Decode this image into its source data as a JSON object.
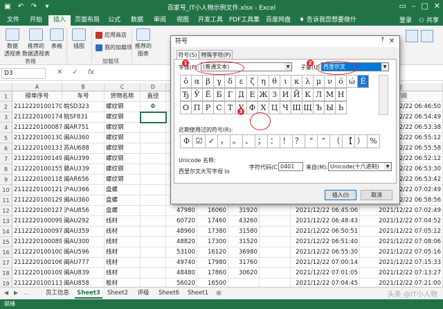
{
  "app": {
    "title": "百家号_IT小人物示例文件.xlsx - Excel",
    "ribbon_tabs": [
      "文件",
      "开始",
      "插入",
      "页面布局",
      "公式",
      "数据",
      "审阅",
      "视图",
      "开发工具",
      "PDF工具集",
      "百度网盘"
    ],
    "active_tab": "插入",
    "tell_me": "告诉我您想要做什么...",
    "login": "登录",
    "share": "共享"
  },
  "ribbon": {
    "pivot": "数据\n透视表",
    "recommended_pivot": "推荐的\n数据透视表",
    "table": "表格",
    "group_tables": "表格",
    "illustrations": "插图",
    "app_store": "应用商店",
    "my_addins": "我的加载项",
    "group_addins": "加载项",
    "recommended_charts": "推荐的\n图表"
  },
  "formula_bar": {
    "name_box": "D3",
    "cancel": "✕",
    "enter": "✓",
    "fx": "fx"
  },
  "sheet": {
    "columns": [
      "A",
      "B",
      "C",
      "D",
      "E",
      "F",
      "G",
      "H",
      "I",
      "J"
    ],
    "headers": [
      "磅单序号",
      "车号",
      "货物名称",
      "直径",
      "",
      "",
      "",
      "",
      "",
      "时间"
    ],
    "rows": [
      {
        "n": "1",
        "cells": [
          "磅单序号",
          "车号",
          "货物名称",
          "直径",
          "",
          "",
          "",
          "",
          "",
          "时间"
        ]
      },
      {
        "n": "2",
        "cells": [
          "2112220100170",
          "皖SD323",
          "螺纹钢",
          "Φ",
          "",
          "",
          "",
          "",
          "",
          "2021/12/22 06:46:50"
        ]
      },
      {
        "n": "3",
        "cells": [
          "2112220100174",
          "皖SF831",
          "螺纹钢",
          "",
          "",
          "",
          "",
          "",
          "",
          "2021/12/22 06:54:49"
        ]
      },
      {
        "n": "4",
        "cells": [
          "2112220100087",
          "闽AR751",
          "螺纹钢",
          "",
          "",
          "",
          "",
          "",
          "",
          "2021/12/22 06:53:38"
        ]
      },
      {
        "n": "5",
        "cells": [
          "2112220100130",
          "闽AU360",
          "螺纹钢",
          "",
          "",
          "",
          "",
          "",
          "",
          "2021/12/22 06:55:12"
        ]
      },
      {
        "n": "6",
        "cells": [
          "2112220100133",
          "苏AU688",
          "螺纹钢",
          "",
          "",
          "",
          "",
          "",
          "",
          "2021/12/22 06:55:58"
        ]
      },
      {
        "n": "7",
        "cells": [
          "2112220100149",
          "闽AU399",
          "螺纹钢",
          "",
          "",
          "",
          "",
          "",
          "",
          "2021/12/22 06:52:12"
        ]
      },
      {
        "n": "8",
        "cells": [
          "2112220100155",
          "赣AU339",
          "螺纹钢",
          "",
          "",
          "",
          "",
          "",
          "",
          "2021/12/22 06:53:30"
        ]
      },
      {
        "n": "9",
        "cells": [
          "2112220100118",
          "闽AR656",
          "螺纹钢",
          "",
          "",
          "",
          "",
          "",
          "",
          "2021/12/22 06:53:42"
        ]
      },
      {
        "n": "10",
        "cells": [
          "2112220100121",
          "沪AU366",
          "盘螺",
          "",
          "",
          "",
          "",
          "",
          "",
          "2021/12/22 07:02:49"
        ]
      },
      {
        "n": "11",
        "cells": [
          "2112220100129",
          "闽AU360",
          "盘螺",
          "",
          "",
          "",
          "",
          "",
          "",
          "2021/12/22 06:58:56"
        ]
      },
      {
        "n": "12",
        "cells": [
          "2112220100127",
          "沪AU856",
          "盘螺",
          "",
          "47980",
          "16060",
          "31920",
          "",
          "2021/12/22 06:45:06",
          "2021/12/22 07:02:49"
        ]
      },
      {
        "n": "13",
        "cells": [
          "2112220100099",
          "闽AU292",
          "线材",
          "",
          "60720",
          "17460",
          "43260",
          "",
          "2021/12/22 06:48:43",
          "2021/12/22 07:04:52"
        ]
      },
      {
        "n": "14",
        "cells": [
          "2112220100097",
          "闽AU359",
          "线材",
          "",
          "48960",
          "17380",
          "31580",
          "",
          "2021/12/22 06:50:51",
          "2021/12/22 07:05:12"
        ]
      },
      {
        "n": "15",
        "cells": [
          "2112220100089",
          "闽AU300",
          "线材",
          "",
          "48820",
          "17300",
          "31520",
          "",
          "2021/12/22 06:51:40",
          "2021/12/22 07:08:06"
        ]
      },
      {
        "n": "16",
        "cells": [
          "2112220100100",
          "闽AU596",
          "线材",
          "",
          "53100",
          "16120",
          "36980",
          "",
          "2021/12/22 06:55:30",
          "2021/12/22 07:05:16"
        ]
      },
      {
        "n": "17",
        "cells": [
          "2112220100106",
          "闽AU777",
          "线材",
          "",
          "49740",
          "17980",
          "31760",
          "",
          "2021/12/22 07:00:14",
          "2021/12/22 07:15:33"
        ]
      },
      {
        "n": "18",
        "cells": [
          "2112220100109",
          "闽AU839",
          "线材",
          "",
          "48480",
          "17860",
          "30620",
          "",
          "2021/12/22 07:01:05",
          "2021/12/22 07:13:27"
        ]
      },
      {
        "n": "19",
        "cells": [
          "2112220100113",
          "闽AU858",
          "板材",
          "",
          "56020",
          "16500",
          "",
          "",
          "2021/12/22 07:04:45",
          "2021/12/22 07:21:00"
        ]
      }
    ]
  },
  "sheet_tabs": [
    "员工信息",
    "Sheet3",
    "Sheet2",
    "评级",
    "Sheet6",
    "Sheet1"
  ],
  "active_sheet": "Sheet3",
  "status": "就绪",
  "dialog": {
    "title": "符号",
    "help": "?",
    "close": "✕",
    "tabs": [
      "符号(S)",
      "特殊字符(P)"
    ],
    "font_label": "字体(F):",
    "font_value": "(普通文本)",
    "subset_label": "子集(U):",
    "subset_value": "西里尔文",
    "char_rows": [
      [
        "ō",
        "α",
        "β",
        "γ",
        "δ",
        "ε",
        "ζ",
        "η",
        "θ",
        "ι",
        "κ",
        "λ",
        "μ",
        "ν",
        "ό",
        "ώ",
        "Ё"
      ],
      [
        "Ђ",
        "Ӯ",
        "Ё",
        "Б",
        "Г",
        "Д",
        "Е",
        "Ж",
        "З",
        "И",
        "Й",
        "К",
        "Л",
        "М",
        "Н"
      ],
      [
        "О",
        "П",
        "Р",
        "С",
        "Т",
        "У",
        "Ф",
        "Х",
        "Ц",
        "Ч",
        "Ш",
        "Щ",
        "Ъ",
        "Ы",
        "Ь"
      ]
    ],
    "recent_label": "近期使用过的符号(R):",
    "recent": [
      "Φ",
      "☑",
      "✓",
      "，",
      "。",
      "、",
      "；",
      "：",
      "！",
      "？",
      "“",
      "”",
      "（",
      "【",
      "）",
      "%"
    ],
    "unicode_name_label": "Unicode 名称:",
    "unicode_name": "西里尔文大写字母 Io",
    "charcode_label": "字符代码(C):",
    "charcode": "0401",
    "from_label": "来自(M):",
    "from_value": "Unicode(十六进制)",
    "insert": "插入(I)",
    "cancel": "取消",
    "badges": [
      "1",
      "2",
      "3"
    ]
  },
  "watermark": "头条 @IT小人物",
  "colors": {
    "excel_green": "#217346",
    "highlight": "#1e73d4",
    "annotation_red": "#e3262e"
  }
}
